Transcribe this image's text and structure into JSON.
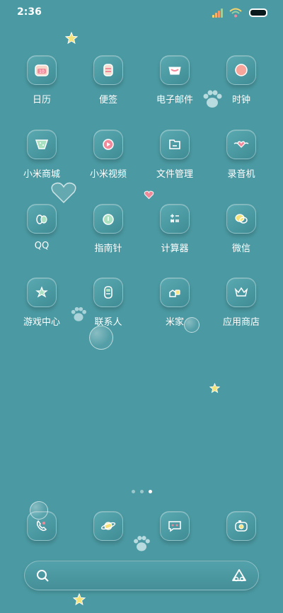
{
  "status": {
    "time": "2:36",
    "signal_colors": [
      "#f6d36b",
      "#f6b36b",
      "#f5986b",
      "#9ad0a0"
    ],
    "battery_color": "#0a1a1c"
  },
  "apps": [
    {
      "label": "日历",
      "icon": "calendar-icon"
    },
    {
      "label": "便签",
      "icon": "notes-icon"
    },
    {
      "label": "电子邮件",
      "icon": "email-icon"
    },
    {
      "label": "时钟",
      "icon": "clock-icon"
    },
    {
      "label": "小米商城",
      "icon": "shopping-icon"
    },
    {
      "label": "小米视频",
      "icon": "video-icon"
    },
    {
      "label": "文件管理",
      "icon": "folder-icon"
    },
    {
      "label": "录音机",
      "icon": "recorder-icon"
    },
    {
      "label": "QQ",
      "icon": "qq-icon"
    },
    {
      "label": "指南针",
      "icon": "compass-icon"
    },
    {
      "label": "计算器",
      "icon": "calculator-icon"
    },
    {
      "label": "微信",
      "icon": "wechat-icon"
    },
    {
      "label": "游戏中心",
      "icon": "game-center-icon"
    },
    {
      "label": "联系人",
      "icon": "contacts-icon"
    },
    {
      "label": "米家",
      "icon": "mijia-icon"
    },
    {
      "label": "应用商店",
      "icon": "app-store-icon"
    }
  ],
  "page_indicator": {
    "count": 3,
    "active": 3
  },
  "dock": [
    {
      "icon": "phone-icon"
    },
    {
      "icon": "browser-planet-icon"
    },
    {
      "icon": "messages-icon"
    },
    {
      "icon": "camera-icon"
    }
  ],
  "colors": {
    "background": "#4b9aa3",
    "accent_pink": "#f08a9a",
    "accent_yellow": "#f4e27a"
  }
}
